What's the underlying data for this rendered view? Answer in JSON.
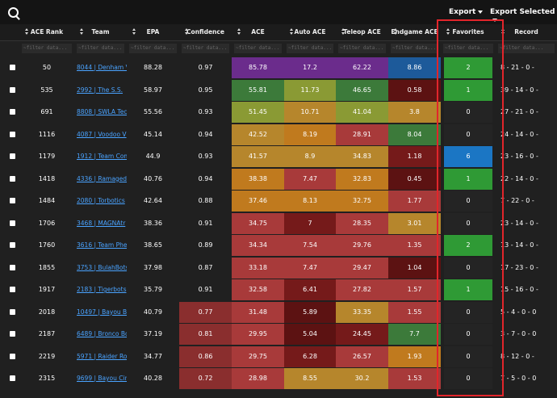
{
  "toolbar": {
    "export_label": "Export",
    "export_selected_label": "Export Selected"
  },
  "columns": [
    {
      "key": "ace_rank",
      "label": "ACE Rank"
    },
    {
      "key": "team",
      "label": "Team"
    },
    {
      "key": "epa",
      "label": "EPA"
    },
    {
      "key": "confidence",
      "label": "Confidence"
    },
    {
      "key": "ace",
      "label": "ACE"
    },
    {
      "key": "auto_ace",
      "label": "Auto ACE"
    },
    {
      "key": "teleop_ace",
      "label": "Teleop ACE"
    },
    {
      "key": "endgame_ace",
      "label": "Endgame ACE"
    },
    {
      "key": "favorites",
      "label": "Favorites"
    },
    {
      "key": "record",
      "label": "Record"
    }
  ],
  "filter_placeholder": "~filter data...",
  "colors": {
    "purple": "#6b2c8c",
    "green_dk": "#3c7a3a",
    "olive": "#8a9a34",
    "gold": "#b6862c",
    "orange": "#c07a1e",
    "red": "#a83a3a",
    "maroon": "#5c1212",
    "dark_red": "#751a1a",
    "blue": "#1d5a9a",
    "bright_green": "#2e9a2e",
    "fav_blue": "#1b76c4",
    "fav_green": "#2f9a35",
    "dark_cell": "#242424",
    "conf_red": "#8a2e2e"
  },
  "rows": [
    {
      "rank": "50",
      "team": "8044 | Denham V",
      "epa": "88.28",
      "confidence": "0.97",
      "ace": "85.78",
      "auto": "17.2",
      "teleop": "62.22",
      "endgame": "8.86",
      "favorites": "2",
      "record": "8 - 21 - 0 -",
      "c": {
        "ace": "purple",
        "auto": "purple",
        "teleop": "purple",
        "endgame": "blue",
        "fav": "fav_green"
      }
    },
    {
      "rank": "535",
      "team": "2992 | The S.S.",
      "epa": "58.97",
      "confidence": "0.95",
      "ace": "55.81",
      "auto": "11.73",
      "teleop": "46.65",
      "endgame": "0.58",
      "favorites": "1",
      "record": "39 - 14 - 0 -",
      "c": {
        "ace": "green_dk",
        "auto": "olive",
        "teleop": "green_dk",
        "endgame": "maroon",
        "fav": "fav_green"
      }
    },
    {
      "rank": "691",
      "team": "8808 | SWLA Tec",
      "epa": "55.56",
      "confidence": "0.93",
      "ace": "51.45",
      "auto": "10.71",
      "teleop": "41.04",
      "endgame": "3.8",
      "favorites": "0",
      "record": "27 - 21 - 0 -",
      "c": {
        "ace": "olive",
        "auto": "gold",
        "teleop": "olive",
        "endgame": "gold",
        "fav": "dark_cell"
      }
    },
    {
      "rank": "1116",
      "team": "4087 | Voodoo V",
      "epa": "45.14",
      "confidence": "0.94",
      "ace": "42.52",
      "auto": "8.19",
      "teleop": "28.91",
      "endgame": "8.04",
      "favorites": "0",
      "record": "24 - 14 - 0 -",
      "c": {
        "ace": "gold",
        "auto": "orange",
        "teleop": "red",
        "endgame": "green_dk",
        "fav": "dark_cell"
      }
    },
    {
      "rank": "1179",
      "team": "1912 | Team Com",
      "epa": "44.9",
      "confidence": "0.93",
      "ace": "41.57",
      "auto": "8.9",
      "teleop": "34.83",
      "endgame": "1.18",
      "favorites": "6",
      "record": "23 - 16 - 0 -",
      "c": {
        "ace": "gold",
        "auto": "gold",
        "teleop": "gold",
        "endgame": "dark_red",
        "fav": "fav_blue"
      }
    },
    {
      "rank": "1418",
      "team": "4336 | Ramaged",
      "epa": "40.76",
      "confidence": "0.94",
      "ace": "38.38",
      "auto": "7.47",
      "teleop": "32.83",
      "endgame": "0.45",
      "favorites": "1",
      "record": "22 - 14 - 0 -",
      "c": {
        "ace": "orange",
        "auto": "red",
        "teleop": "orange",
        "endgame": "maroon",
        "fav": "fav_green"
      }
    },
    {
      "rank": "1484",
      "team": "2080 | Torbotics",
      "epa": "42.64",
      "confidence": "0.88",
      "ace": "37.46",
      "auto": "8.13",
      "teleop": "32.75",
      "endgame": "1.77",
      "favorites": "0",
      "record": "7 - 22 - 0 -",
      "c": {
        "ace": "orange",
        "auto": "orange",
        "teleop": "orange",
        "endgame": "red",
        "fav": "dark_cell"
      }
    },
    {
      "rank": "1706",
      "team": "3468 | MAGNAtr",
      "epa": "38.36",
      "confidence": "0.91",
      "ace": "34.75",
      "auto": "7",
      "teleop": "28.35",
      "endgame": "3.01",
      "favorites": "0",
      "record": "23 - 14 - 0 -",
      "c": {
        "ace": "red",
        "auto": "dark_red",
        "teleop": "red",
        "endgame": "gold",
        "fav": "dark_cell"
      }
    },
    {
      "rank": "1760",
      "team": "3616 | Team Phe",
      "epa": "38.65",
      "confidence": "0.89",
      "ace": "34.34",
      "auto": "7.54",
      "teleop": "29.76",
      "endgame": "1.35",
      "favorites": "2",
      "record": "13 - 14 - 0 -",
      "c": {
        "ace": "red",
        "auto": "red",
        "teleop": "red",
        "endgame": "red",
        "fav": "fav_green"
      }
    },
    {
      "rank": "1855",
      "team": "3753 | BulahBots",
      "epa": "37.98",
      "confidence": "0.87",
      "ace": "33.18",
      "auto": "7.47",
      "teleop": "29.47",
      "endgame": "1.04",
      "favorites": "0",
      "record": "17 - 23 - 0 -",
      "c": {
        "ace": "red",
        "auto": "red",
        "teleop": "red",
        "endgame": "maroon",
        "fav": "dark_cell"
      }
    },
    {
      "rank": "1917",
      "team": "2183 | Tigerbots",
      "epa": "35.79",
      "confidence": "0.91",
      "ace": "32.58",
      "auto": "6.41",
      "teleop": "27.82",
      "endgame": "1.57",
      "favorites": "1",
      "record": "15 - 16 - 0 -",
      "c": {
        "ace": "red",
        "auto": "dark_red",
        "teleop": "red",
        "endgame": "red",
        "fav": "fav_green"
      }
    },
    {
      "rank": "2018",
      "team": "10497 | Bayou B",
      "epa": "40.79",
      "confidence": "0.77",
      "ace": "31.48",
      "auto": "5.89",
      "teleop": "33.35",
      "endgame": "1.55",
      "favorites": "0",
      "record": "5 - 4 - 0 - 0",
      "c": {
        "conf": "conf_red",
        "ace": "red",
        "auto": "maroon",
        "teleop": "gold",
        "endgame": "red",
        "fav": "dark_cell"
      }
    },
    {
      "rank": "2187",
      "team": "6489 | Bronco Bo",
      "epa": "37.19",
      "confidence": "0.81",
      "ace": "29.95",
      "auto": "5.04",
      "teleop": "24.45",
      "endgame": "7.7",
      "favorites": "0",
      "record": "3 - 7 - 0 - 0",
      "c": {
        "conf": "conf_red",
        "ace": "red",
        "auto": "maroon",
        "teleop": "dark_red",
        "endgame": "green_dk",
        "fav": "dark_cell"
      }
    },
    {
      "rank": "2219",
      "team": "5971 | Raider Ro",
      "epa": "34.77",
      "confidence": "0.86",
      "ace": "29.75",
      "auto": "6.28",
      "teleop": "26.57",
      "endgame": "1.93",
      "favorites": "0",
      "record": "8 - 12 - 0 -",
      "c": {
        "conf": "conf_red",
        "ace": "red",
        "auto": "dark_red",
        "teleop": "red",
        "endgame": "orange",
        "fav": "dark_cell"
      }
    },
    {
      "rank": "2315",
      "team": "9699 | Bayou Cir",
      "epa": "40.28",
      "confidence": "0.72",
      "ace": "28.98",
      "auto": "8.55",
      "teleop": "30.2",
      "endgame": "1.53",
      "favorites": "0",
      "record": "7 - 5 - 0 - 0",
      "c": {
        "conf": "conf_red",
        "ace": "red",
        "auto": "gold",
        "teleop": "gold",
        "endgame": "red",
        "fav": "dark_cell"
      }
    }
  ]
}
